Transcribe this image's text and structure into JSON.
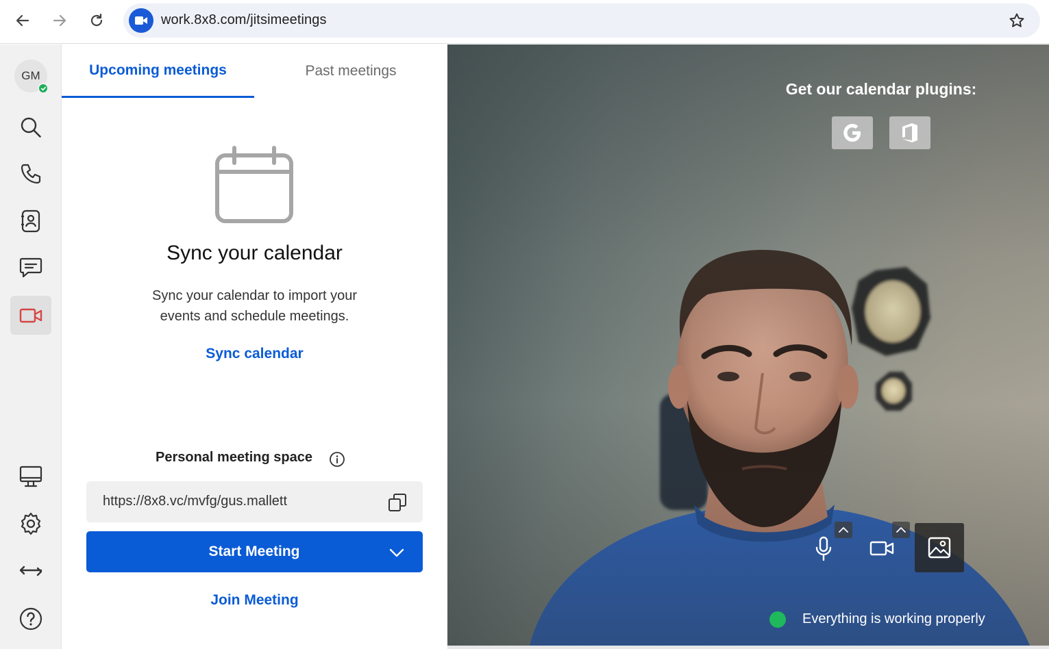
{
  "browser": {
    "url": "work.8x8.com/jitsimeetings"
  },
  "user": {
    "initials": "GM"
  },
  "tabs": {
    "upcoming": "Upcoming meetings",
    "past": "Past meetings"
  },
  "empty_state": {
    "title": "Sync your calendar",
    "description": "Sync your calendar to import your events and schedule meetings.",
    "link": "Sync calendar"
  },
  "personal_space": {
    "label": "Personal meeting space",
    "url": "https://8x8.vc/mvfg/gus.mallett"
  },
  "actions": {
    "start": "Start Meeting",
    "join": "Join Meeting"
  },
  "preview": {
    "plugins_title": "Get our calendar plugins:",
    "status": "Everything is working properly"
  },
  "colors": {
    "accent": "#0a5bd6",
    "presence": "#1fae5b",
    "active_video_icon": "#d64545"
  }
}
